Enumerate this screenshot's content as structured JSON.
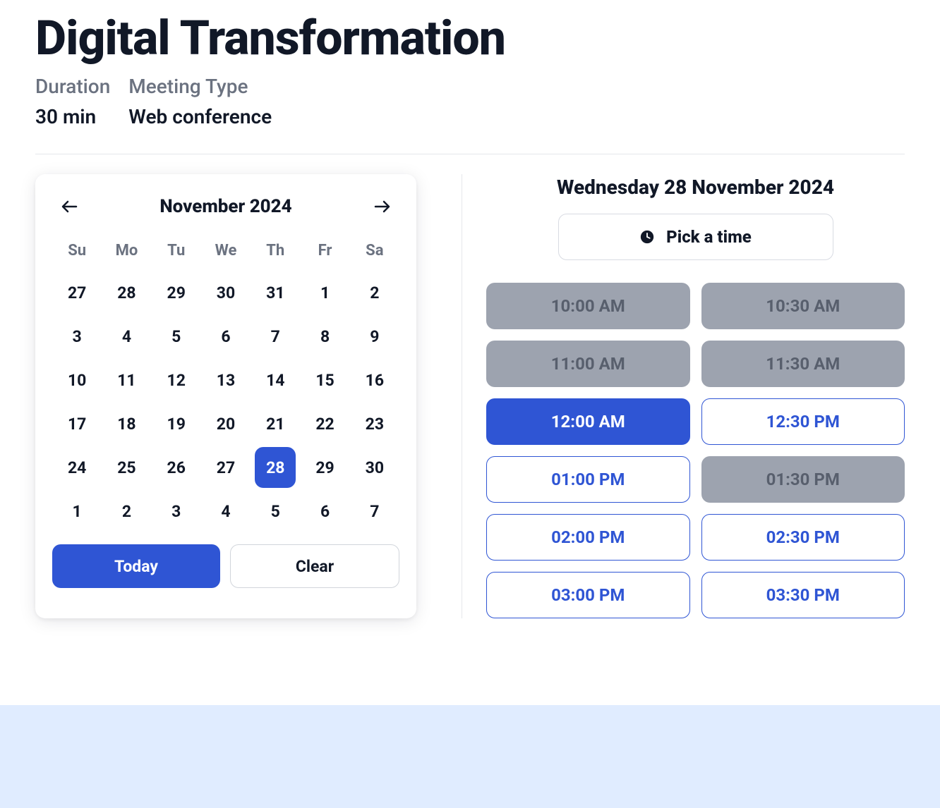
{
  "header": {
    "title": "Digital Transformation",
    "duration_label": "Duration",
    "duration_value": "30 min",
    "type_label": "Meeting Type",
    "type_value": "Web conference"
  },
  "calendar": {
    "month_label": "November 2024",
    "today_label": "Today",
    "clear_label": "Clear",
    "weekdays": [
      "Su",
      "Mo",
      "Tu",
      "We",
      "Th",
      "Fr",
      "Sa"
    ],
    "weeks": [
      [
        {
          "d": "27"
        },
        {
          "d": "28"
        },
        {
          "d": "29"
        },
        {
          "d": "30"
        },
        {
          "d": "31"
        },
        {
          "d": "1"
        },
        {
          "d": "2"
        }
      ],
      [
        {
          "d": "3"
        },
        {
          "d": "4"
        },
        {
          "d": "5"
        },
        {
          "d": "6"
        },
        {
          "d": "7"
        },
        {
          "d": "8"
        },
        {
          "d": "9"
        }
      ],
      [
        {
          "d": "10"
        },
        {
          "d": "11"
        },
        {
          "d": "12"
        },
        {
          "d": "13"
        },
        {
          "d": "14"
        },
        {
          "d": "15"
        },
        {
          "d": "16"
        }
      ],
      [
        {
          "d": "17"
        },
        {
          "d": "18"
        },
        {
          "d": "19"
        },
        {
          "d": "20"
        },
        {
          "d": "21"
        },
        {
          "d": "22"
        },
        {
          "d": "23"
        }
      ],
      [
        {
          "d": "24"
        },
        {
          "d": "25"
        },
        {
          "d": "26"
        },
        {
          "d": "27"
        },
        {
          "d": "28",
          "selected": true
        },
        {
          "d": "29"
        },
        {
          "d": "30"
        }
      ],
      [
        {
          "d": "1"
        },
        {
          "d": "2"
        },
        {
          "d": "3"
        },
        {
          "d": "4"
        },
        {
          "d": "5"
        },
        {
          "d": "6"
        },
        {
          "d": "7"
        }
      ]
    ]
  },
  "times": {
    "selected_date": "Wednesday 28 November 2024",
    "pick_label": "Pick a time",
    "slots": [
      {
        "t": "10:00 AM",
        "state": "disabled"
      },
      {
        "t": "10:30 AM",
        "state": "disabled"
      },
      {
        "t": "11:00 AM",
        "state": "disabled"
      },
      {
        "t": "11:30 AM",
        "state": "disabled"
      },
      {
        "t": "12:00 AM",
        "state": "selected"
      },
      {
        "t": "12:30 PM",
        "state": "available"
      },
      {
        "t": "01:00 PM",
        "state": "available"
      },
      {
        "t": "01:30 PM",
        "state": "disabled"
      },
      {
        "t": "02:00 PM",
        "state": "available"
      },
      {
        "t": "02:30 PM",
        "state": "available"
      },
      {
        "t": "03:00 PM",
        "state": "available"
      },
      {
        "t": "03:30 PM",
        "state": "available"
      }
    ]
  }
}
